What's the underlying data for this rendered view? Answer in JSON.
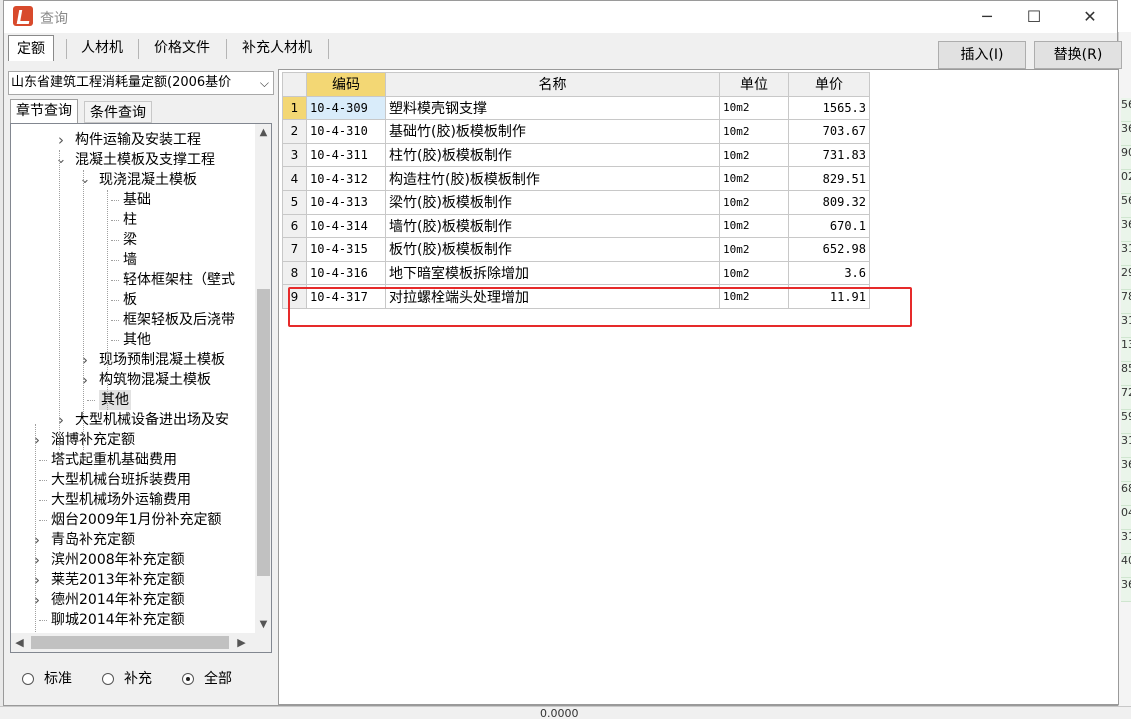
{
  "window": {
    "title": "查询",
    "controls": {
      "minimize": "─",
      "maximize": "☐",
      "close": "✕"
    }
  },
  "tabs": [
    "定额",
    "人材机",
    "价格文件",
    "补充人材机"
  ],
  "buttons": {
    "insert": "插入(I)",
    "replace": "替换(R)"
  },
  "left_panel": {
    "quota_library": "山东省建筑工程消耗量定额(2006基价",
    "subtabs": [
      "章节查询",
      "条件查询"
    ],
    "tree": [
      {
        "label": "构件运输及安装工程",
        "expander": "›",
        "selected": false
      },
      {
        "label": "混凝土模板及支撑工程",
        "expander": "⌄",
        "selected": false
      },
      {
        "label": "现浇混凝土模板",
        "expander": "⌄",
        "selected": false
      },
      {
        "label": "基础",
        "expander": "",
        "selected": false
      },
      {
        "label": "柱",
        "expander": "",
        "selected": false
      },
      {
        "label": "梁",
        "expander": "",
        "selected": false
      },
      {
        "label": "墙",
        "expander": "",
        "selected": false
      },
      {
        "label": "轻体框架柱（壁式",
        "expander": "",
        "selected": false
      },
      {
        "label": "板",
        "expander": "",
        "selected": false
      },
      {
        "label": "框架轻板及后浇带",
        "expander": "",
        "selected": false
      },
      {
        "label": "其他",
        "expander": "",
        "selected": false
      },
      {
        "label": "现场预制混凝土模板",
        "expander": "›",
        "selected": false
      },
      {
        "label": "构筑物混凝土模板",
        "expander": "›",
        "selected": false
      },
      {
        "label": "其他",
        "expander": "",
        "selected": true
      },
      {
        "label": "大型机械设备进出场及安",
        "expander": "›",
        "selected": false
      },
      {
        "label": "淄博补充定额",
        "expander": "›",
        "selected": false
      },
      {
        "label": "塔式起重机基础费用",
        "expander": "",
        "selected": false
      },
      {
        "label": "大型机械台班拆装费用",
        "expander": "",
        "selected": false
      },
      {
        "label": "大型机械场外运输费用",
        "expander": "",
        "selected": false
      },
      {
        "label": "烟台2009年1月份补充定额",
        "expander": "",
        "selected": false
      },
      {
        "label": "青岛补充定额",
        "expander": "›",
        "selected": false
      },
      {
        "label": "滨州2008年补充定额",
        "expander": "›",
        "selected": false
      },
      {
        "label": "莱芜2013年补充定额",
        "expander": "›",
        "selected": false
      },
      {
        "label": "德州2014年补充定额",
        "expander": "›",
        "selected": false
      },
      {
        "label": "聊城2014年补充定额",
        "expander": "",
        "selected": false
      }
    ],
    "filters": [
      {
        "label": "标准",
        "checked": false
      },
      {
        "label": "补充",
        "checked": false
      },
      {
        "label": "全部",
        "checked": true
      }
    ]
  },
  "grid": {
    "columns": [
      "编码",
      "名称",
      "单位",
      "单价"
    ],
    "rows": [
      {
        "no": "1",
        "code": "10-4-309",
        "name": "塑料模壳钢支撑",
        "unit": "10m2",
        "price": "1565.3"
      },
      {
        "no": "2",
        "code": "10-4-310",
        "name": "基础竹(胶)板模板制作",
        "unit": "10m2",
        "price": "703.67"
      },
      {
        "no": "3",
        "code": "10-4-311",
        "name": "柱竹(胶)板模板制作",
        "unit": "10m2",
        "price": "731.83"
      },
      {
        "no": "4",
        "code": "10-4-312",
        "name": "构造柱竹(胶)板模板制作",
        "unit": "10m2",
        "price": "829.51"
      },
      {
        "no": "5",
        "code": "10-4-313",
        "name": "梁竹(胶)板模板制作",
        "unit": "10m2",
        "price": "809.32"
      },
      {
        "no": "6",
        "code": "10-4-314",
        "name": "墙竹(胶)板模板制作",
        "unit": "10m2",
        "price": "670.1"
      },
      {
        "no": "7",
        "code": "10-4-315",
        "name": "板竹(胶)板模板制作",
        "unit": "10m2",
        "price": "652.98"
      },
      {
        "no": "8",
        "code": "10-4-316",
        "name": "地下暗室模板拆除增加",
        "unit": "10m2",
        "price": "3.6"
      },
      {
        "no": "9",
        "code": "10-4-317",
        "name": "对拉螺栓端头处理增加",
        "unit": "10m2",
        "price": "11.91"
      }
    ],
    "selected_row": 0,
    "highlighted_row": 8
  },
  "colors": {
    "header_highlight": "#f3d774",
    "annotation_box": "#e62a2a",
    "selected_cell": "#d9ecfa"
  },
  "background": {
    "right_cells": [
      "56",
      "36",
      "90",
      "02",
      "56",
      "36",
      "31",
      "29",
      "78",
      "31",
      "13",
      "85",
      "72",
      "59",
      "31",
      "36",
      "68",
      "04",
      "31",
      "40",
      "36"
    ],
    "bottom_value": "0.0000"
  }
}
